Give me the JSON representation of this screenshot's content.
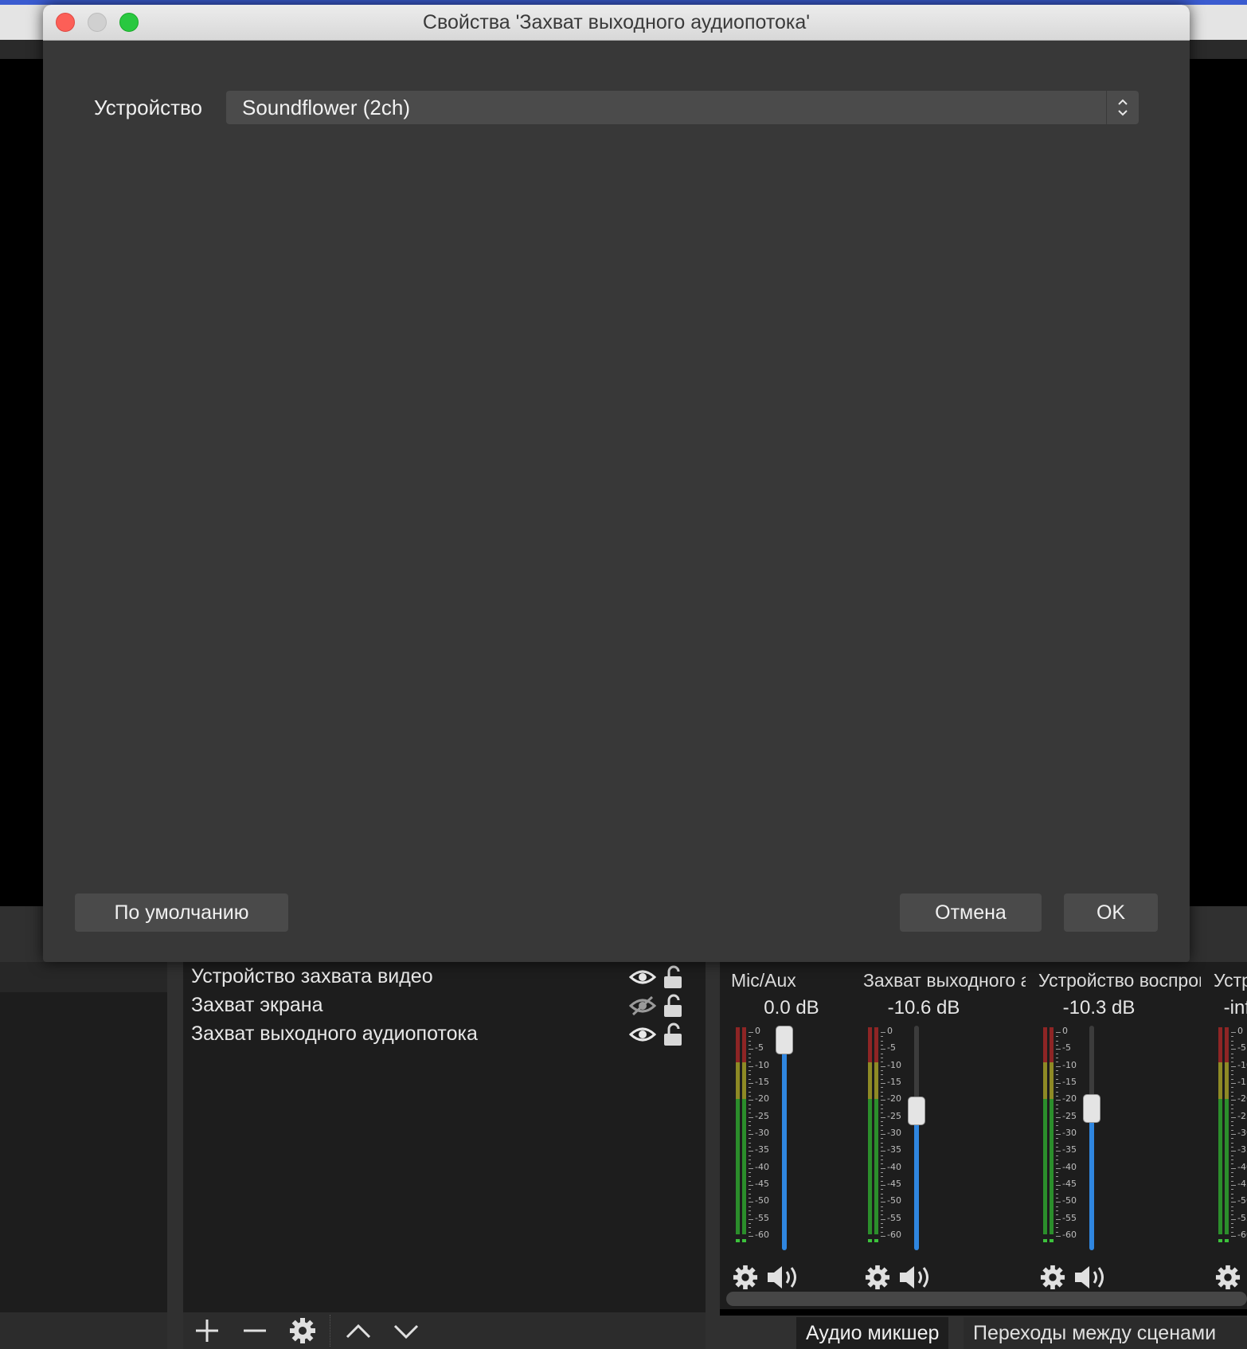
{
  "dialog": {
    "title": "Свойства 'Захват выходного аудиопотока'",
    "device_label": "Устройство",
    "device_value": "Soundflower (2ch)",
    "defaults_button": "По умолчанию",
    "cancel_button": "Отмена",
    "ok_button": "OK"
  },
  "sources": {
    "items": [
      {
        "label": "Устройство захвата видео",
        "visible": true
      },
      {
        "label": "Захват экрана",
        "visible": false
      },
      {
        "label": "Захват выходного аудиопотока",
        "visible": true
      }
    ]
  },
  "mixer": {
    "channels": [
      {
        "name": "Mic/Aux",
        "db": "0.0 dB",
        "volume": 1.0
      },
      {
        "name": "Захват выходного аудиопотока",
        "db": "-10.6 dB",
        "volume": 0.64
      },
      {
        "name": "Устройство воспроизведения",
        "db": "-10.3 dB",
        "volume": 0.65
      },
      {
        "name": "Устройство",
        "db": "-inf",
        "volume": 0.0
      }
    ],
    "scale_labels": [
      "0",
      "-5",
      "-10",
      "-15",
      "-20",
      "-25",
      "-30",
      "-35",
      "-40",
      "-45",
      "-50",
      "-55",
      "-60"
    ],
    "tabs": [
      "Аудио микшер",
      "Переходы между сценами"
    ]
  },
  "colors": {
    "accent": "#2f86e0",
    "meter_red": "#8e2525",
    "meter_yellow": "#8e8a25",
    "meter_green": "#2b8e2b"
  }
}
